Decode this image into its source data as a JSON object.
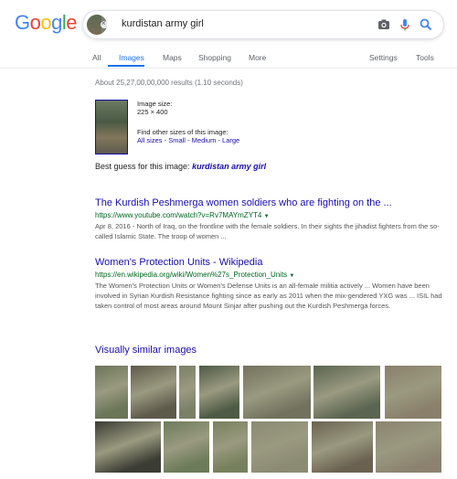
{
  "logo": {
    "text": "Google"
  },
  "search": {
    "query": "kurdistan army girl",
    "icons": [
      "camera-icon",
      "microphone-icon",
      "search-icon"
    ]
  },
  "nav": {
    "all": "All",
    "images": "Images",
    "maps": "Maps",
    "shopping": "Shopping",
    "more": "More",
    "settings": "Settings",
    "tools": "Tools"
  },
  "stats": "About 25,27,00,00,000 results (1.10 seconds)",
  "image_info": {
    "size_label": "Image size:",
    "size_value": "225 × 400",
    "find_sizes": "Find other sizes of this image:",
    "links": [
      "All sizes",
      "Small",
      "Medium",
      "Large"
    ]
  },
  "best_guess": {
    "label": "Best guess for this image:",
    "value": "kurdistan army girl"
  },
  "results": [
    {
      "title": "The Kurdish Peshmerga women soldiers who are fighting on the ...",
      "url": "https://www.youtube.com/watch?v=Rv7MAYmZYT4",
      "snippet": "Apr 8, 2016 - North of Iraq, on the frontline with the female soldiers. In their sights the jihadist fighters from the so-called Islamic State. The troop of women ..."
    },
    {
      "title": "Women's Protection Units - Wikipedia",
      "url": "https://en.wikipedia.org/wiki/Women%27s_Protection_Units",
      "snippet": "The Women's Protection Units or Women's Defense Units is an all-female militia actively ... Women have been involved in Syrian Kurdish Resistance fighting since as early as 2011 when the mix-gendered YXG was ... ISIL had taken control of most areas around Mount Sinjar after pushing out the Kurdish Peshmerga forces."
    }
  ],
  "visually_similar": {
    "heading": "Visually similar images",
    "row1_colors": [
      "#6b7558",
      "#5e5a4a",
      "#7a8068",
      "#4e5a45",
      "#71715e",
      "#5a6450",
      "#8a7f6a"
    ],
    "row2_colors": [
      "#3b3c33",
      "#6c7b5a",
      "#77805c",
      "#8b8a73",
      "#6a6150",
      "#8c826f",
      "#735f4a"
    ]
  },
  "colors": {
    "link": "#1a0dab",
    "url": "#006621",
    "accent": "#1a73e8"
  }
}
